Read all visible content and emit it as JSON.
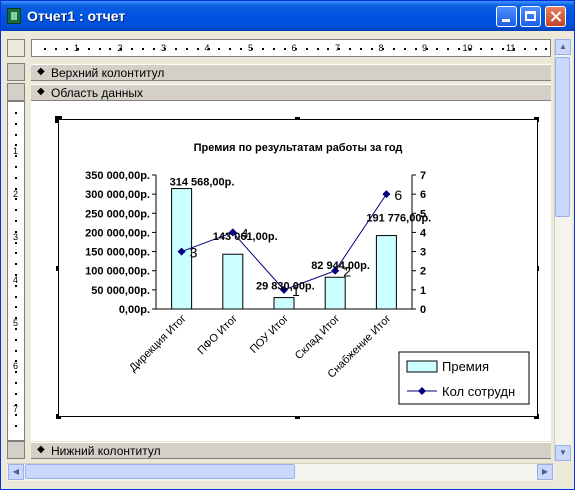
{
  "window": {
    "title": "Отчет1 : отчет"
  },
  "ruler": {
    "top_numbers": [
      "1",
      "2",
      "3",
      "4",
      "5",
      "6",
      "7",
      "8",
      "9",
      "10",
      "11"
    ],
    "left_numbers": [
      "1",
      "2",
      "3",
      "4",
      "5",
      "6",
      "7"
    ]
  },
  "sections": {
    "page_header": "Верхний колонтитул",
    "detail": "Область данных",
    "page_footer": "Нижний колонтитул"
  },
  "colors": {
    "bar_fill": "#ccffff",
    "line": "#000080",
    "titlebar": "#0054e3"
  },
  "chart_data": {
    "type": "bar",
    "title": "Премия по результатам работы за год",
    "categories": [
      "Дирекция Итог",
      "ПФО Итог",
      "ПОУ Итог",
      "Склад Итог",
      "Снабжение Итог"
    ],
    "series": [
      {
        "name": "Премия",
        "type": "bar",
        "axis": "left",
        "values": [
          314568,
          143061,
          29830,
          82944,
          191776
        ],
        "labels": [
          "314 568,00р.",
          "143 061,00р.",
          "29 830,00р.",
          "82 944,00р.",
          "191 776,00р."
        ]
      },
      {
        "name": "Кол сотрудн",
        "type": "line",
        "axis": "right",
        "values": [
          3,
          4,
          1,
          2,
          6
        ],
        "labels": [
          "3",
          "4",
          "1",
          "2",
          "6"
        ]
      }
    ],
    "y_left": {
      "min": 0,
      "max": 350000,
      "ticks": [
        "0,00р.",
        "50 000,00р.",
        "100 000,00р.",
        "150 000,00р.",
        "200 000,00р.",
        "250 000,00р.",
        "300 000,00р.",
        "350 000,00р."
      ]
    },
    "y_right": {
      "min": 0,
      "max": 7,
      "ticks": [
        "0",
        "1",
        "2",
        "3",
        "4",
        "5",
        "6",
        "7"
      ]
    },
    "legend_position": "bottom-right",
    "grid": false
  }
}
